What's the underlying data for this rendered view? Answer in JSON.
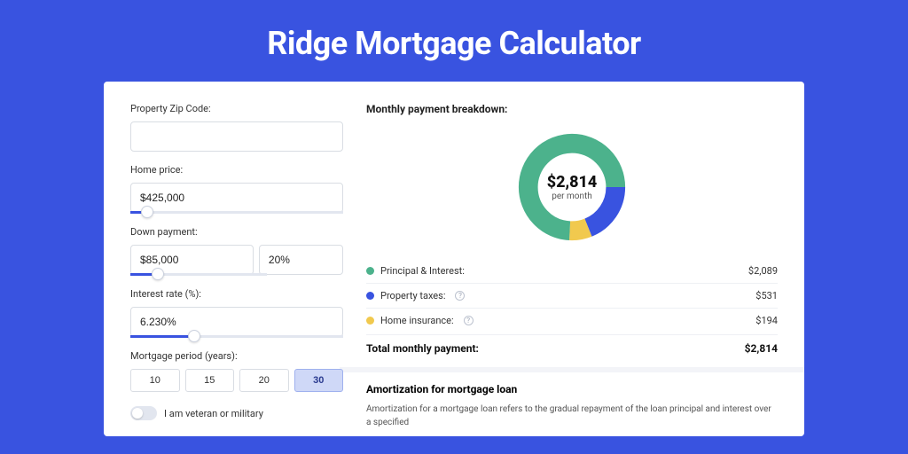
{
  "title": "Ridge Mortgage Calculator",
  "colors": {
    "principal": "#4cb28c",
    "taxes": "#3953e0",
    "insurance": "#f1c94e"
  },
  "form": {
    "zip": {
      "label": "Property Zip Code:",
      "value": ""
    },
    "home_price": {
      "label": "Home price:",
      "value": "$425,000",
      "slider_pct": 8
    },
    "down_payment": {
      "label": "Down payment:",
      "value": "$85,000",
      "pct": "20%",
      "slider_pct": 20
    },
    "interest": {
      "label": "Interest rate (%):",
      "value": "6.230%",
      "slider_pct": 30
    },
    "period": {
      "label": "Mortgage period (years):",
      "options": [
        "10",
        "15",
        "20",
        "30"
      ],
      "selected": "30"
    },
    "veteran": {
      "label": "I am veteran or military",
      "on": false
    }
  },
  "breakdown": {
    "title": "Monthly payment breakdown:",
    "center_amount": "$2,814",
    "center_sub": "per month",
    "rows": [
      {
        "label": "Principal & Interest:",
        "value": "$2,089",
        "color": "principal",
        "help": false
      },
      {
        "label": "Property taxes:",
        "value": "$531",
        "color": "taxes",
        "help": true
      },
      {
        "label": "Home insurance:",
        "value": "$194",
        "color": "insurance",
        "help": true
      }
    ],
    "total_label": "Total monthly payment:",
    "total_value": "$2,814"
  },
  "amort": {
    "title": "Amortization for mortgage loan",
    "text": "Amortization for a mortgage loan refers to the gradual repayment of the loan principal and interest over a specified"
  },
  "chart_data": {
    "type": "pie",
    "title": "Monthly payment breakdown",
    "series": [
      {
        "name": "Principal & Interest",
        "value": 2089,
        "color": "#4cb28c"
      },
      {
        "name": "Property taxes",
        "value": 531,
        "color": "#3953e0"
      },
      {
        "name": "Home insurance",
        "value": 194,
        "color": "#f1c94e"
      }
    ],
    "total": 2814,
    "center_label": "$2,814 per month"
  }
}
